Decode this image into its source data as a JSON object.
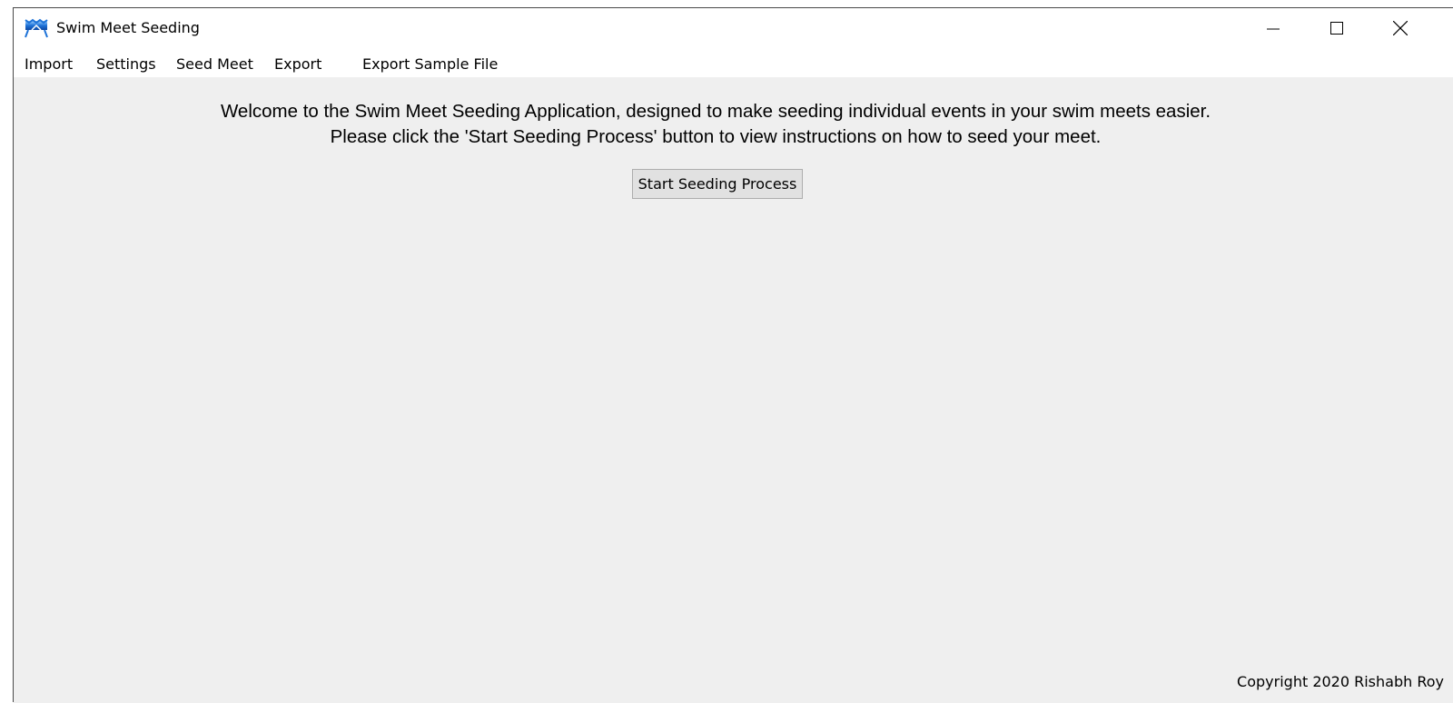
{
  "window": {
    "title": "Swim Meet Seeding",
    "app_icon": "swimmer-wave-icon",
    "controls": {
      "minimize_icon": "minimize-icon",
      "maximize_icon": "maximize-icon",
      "close_icon": "close-icon"
    }
  },
  "menubar": {
    "items": [
      {
        "label": "Import"
      },
      {
        "label": "Settings"
      },
      {
        "label": "Seed Meet"
      },
      {
        "label": "Export"
      },
      {
        "label": "Export Sample File"
      }
    ]
  },
  "main": {
    "welcome_line1": "Welcome to the Swim Meet Seeding Application, designed to make seeding individual events in your swim meets easier.",
    "welcome_line2": "Please click the 'Start Seeding Process' button to view instructions on how to seed your meet.",
    "start_button_label": "Start Seeding Process"
  },
  "footer": {
    "copyright": "Copyright 2020 Rishabh Roy"
  },
  "colors": {
    "content_background": "#efefef",
    "button_background": "#e1e1e1",
    "button_border": "#adadad",
    "icon_blue": "#1e73d8"
  }
}
